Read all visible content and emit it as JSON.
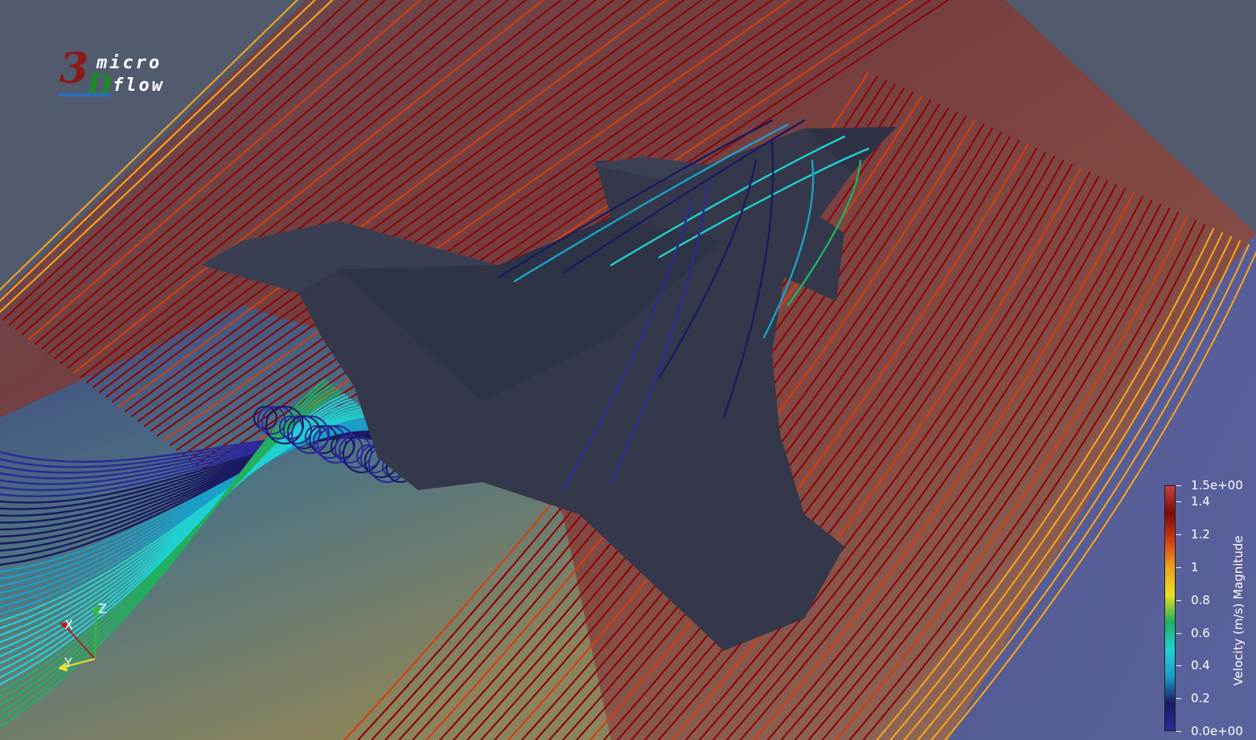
{
  "logo": {
    "digit": "3",
    "letter": "D",
    "word_top": "micro",
    "word_bottom": "flow",
    "digit_color": "#8b1a1a",
    "letter_color": "#1e8a2a",
    "swoosh_color": "#2a6fbf"
  },
  "orientation_axes": {
    "x_label": "X",
    "y_label": "Y",
    "z_label": "Z",
    "x_color": "#b02020",
    "y_color": "#e8e030",
    "z_color": "#30c030"
  },
  "colorbar": {
    "title": "Velocity (m/s) Magnitude",
    "max_label": "1.5e+00",
    "min_label": "0.0e+00",
    "ticks": [
      {
        "value": 1.5,
        "label": "1.5e+00"
      },
      {
        "value": 1.4,
        "label": "1.4"
      },
      {
        "value": 1.2,
        "label": "1.2"
      },
      {
        "value": 1.0,
        "label": "1"
      },
      {
        "value": 0.8,
        "label": "0.8"
      },
      {
        "value": 0.6,
        "label": "0.6"
      },
      {
        "value": 0.4,
        "label": "0.4"
      },
      {
        "value": 0.2,
        "label": "0.2"
      },
      {
        "value": 0.0,
        "label": "0.0e+00"
      }
    ],
    "range": [
      0.0,
      1.5
    ],
    "colormap": [
      "#2a2a9a",
      "#1a1a60",
      "#1aa0c8",
      "#20d0d0",
      "#20b060",
      "#e8e020",
      "#f0a020",
      "#d04010",
      "#7a0a0a",
      "#c84040"
    ]
  },
  "scene": {
    "background": "#525a6e",
    "body_color": "#34384a"
  }
}
